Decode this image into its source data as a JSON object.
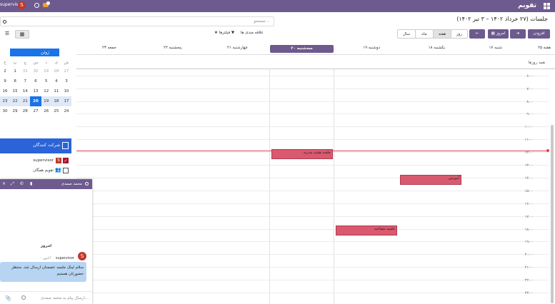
{
  "topbar": {
    "app_title": "تقویم",
    "user_name": "supervisor",
    "avatar_letter": "S"
  },
  "title": "جلسات (۲۷ خرداد ۱۴۰۲ – ۳ تیر ۱۴۰۲)",
  "search": {
    "placeholder": "جستجو..."
  },
  "toolbar": {
    "add_label": "افزودن",
    "today_label": "امروز",
    "views": {
      "day": "روز",
      "week": "هفته",
      "month": "ماه",
      "year": "سال"
    },
    "filters_label": "فیلترها",
    "favorites_label": "علاقه مندی ها"
  },
  "calendar": {
    "week_label": "هفته ۲۵",
    "days": [
      "شنبه ۱۷",
      "یکشنبه ۱۸",
      "دوشنبه ۱۹",
      "سه‌شنبه ۲۰",
      "چهارشنبه ۲۱",
      "پنجشنبه ۲۲",
      "جمعه ۲۳"
    ],
    "all_day_label": "همه روزها",
    "hours": [
      "۶:۰۰",
      "۷:۰۰",
      "۸:۰۰",
      "۹:۰۰",
      "۱۰:۰۰",
      "۱۱:۰۰",
      "۱۲:۰۰",
      "۱۳:۰۰",
      "۱۴:۰۰",
      "۱۵:۰۰",
      "۱۶:۰۰",
      "۱۷:۰۰",
      "۱۸:۰۰",
      "۱۹:۰۰",
      "۲۰:۰۰",
      "۲۱:۰۰",
      "۲۲:۰۰",
      "۲۳:۰۰"
    ],
    "events": [
      {
        "title": "جلسه هیئت مدیره",
        "day": "سه‌شنبه ۲۰"
      },
      {
        "title": "آموزش",
        "day": "یکشنبه ۱۸"
      },
      {
        "title": "جلسه مصاحبه",
        "day": "دوشنبه ۱۹"
      }
    ]
  },
  "mini_calendar": {
    "month_label": "ژوئن 2023",
    "weekdays": [
      "ش",
      "ی",
      "د",
      "س",
      "چ",
      "پ",
      "ج"
    ],
    "weeks": [
      [
        "1",
        "26",
        "27",
        "28",
        "29",
        "30",
        "31",
        "1",
        "2"
      ],
      [
        "3",
        "4",
        "5",
        "6",
        "7",
        "8",
        "9"
      ],
      [
        "10",
        "11",
        "12",
        "13",
        "14",
        "15",
        "16"
      ],
      [
        "17",
        "18",
        "19",
        "20",
        "21",
        "22",
        "23"
      ],
      [
        "24",
        "25",
        "26",
        "27",
        "28",
        "29",
        "30"
      ]
    ]
  },
  "attendees": {
    "header": "شرکت کنندگان",
    "items": [
      {
        "name": "supervisor",
        "badge": "S"
      },
      {
        "name": "تقویم همگان"
      }
    ]
  },
  "chat": {
    "contact_name": "محمد صمدی",
    "day_separator": "امروز",
    "message_author": "supervisor",
    "message_time": "- اکنون",
    "message_text": "سلام لینک جلسه عضمتان ارسال شد. منتظر حضورتان هستیم",
    "composer_placeholder": "ارسال پیام به محمد صمدی..."
  }
}
